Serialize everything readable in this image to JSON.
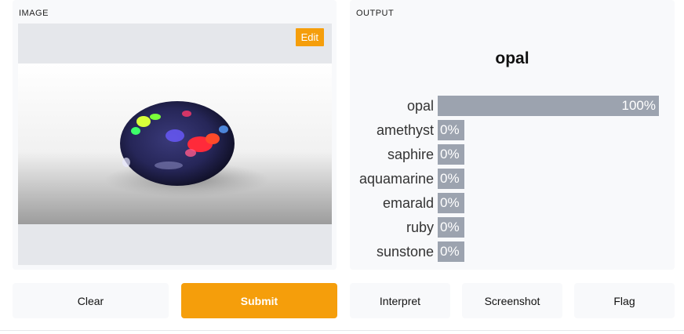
{
  "input": {
    "label": "IMAGE",
    "edit_label": "Edit",
    "image_subject": "opal-gemstone-photo"
  },
  "output": {
    "label": "OUTPUT",
    "title": "opal",
    "results": [
      {
        "label": "opal",
        "pct_text": "100%",
        "value": 1.0
      },
      {
        "label": "amethyst",
        "pct_text": "0%",
        "value": 0.0
      },
      {
        "label": "saphire",
        "pct_text": "0%",
        "value": 0.0
      },
      {
        "label": "aquamarine",
        "pct_text": "0%",
        "value": 0.0
      },
      {
        "label": "emarald",
        "pct_text": "0%",
        "value": 0.0
      },
      {
        "label": "ruby",
        "pct_text": "0%",
        "value": 0.0
      },
      {
        "label": "sunstone",
        "pct_text": "0%",
        "value": 0.0
      }
    ]
  },
  "buttons": {
    "clear": "Clear",
    "submit": "Submit",
    "interpret": "Interpret",
    "screenshot": "Screenshot",
    "flag": "Flag"
  },
  "colors": {
    "accent": "#f59e0b",
    "bar": "#9ca3af",
    "panel": "#f8f9fb"
  }
}
